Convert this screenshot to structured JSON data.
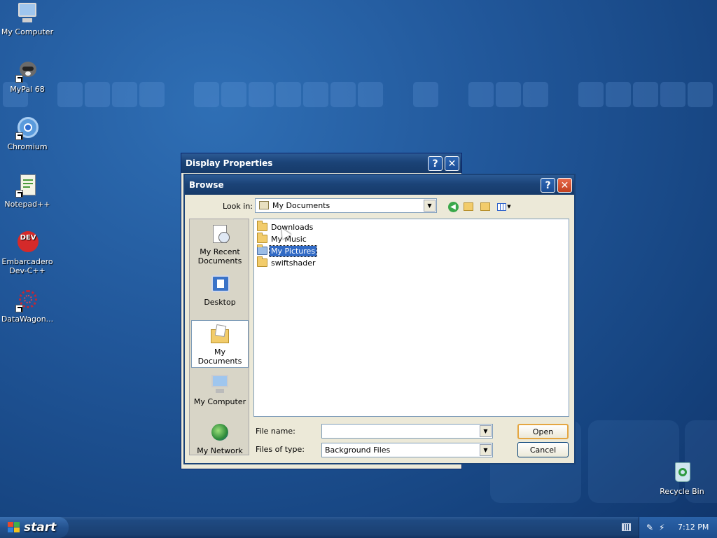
{
  "desktop": {
    "icons": [
      {
        "label": "My Computer",
        "icon": "my-computer-icon"
      },
      {
        "label": "MyPal 68",
        "icon": "mypal-raccoon-icon"
      },
      {
        "label": "Chromium",
        "icon": "chromium-icon"
      },
      {
        "label": "Notepad++",
        "icon": "notepadpp-icon"
      },
      {
        "label": "Embarcadero Dev-C++",
        "icon": "devcpp-icon",
        "badge": "DEV"
      },
      {
        "label": "DataWagon...",
        "icon": "datawagon-icon"
      },
      {
        "label": "Recycle Bin",
        "icon": "recycle-bin-icon"
      }
    ]
  },
  "display_properties": {
    "title": "Display Properties",
    "help": "?",
    "close": "✕"
  },
  "browse": {
    "title": "Browse",
    "help": "?",
    "close": "✕",
    "look_in_label": "Look in:",
    "look_in_value": "My Documents",
    "places": [
      {
        "label": "My Recent Documents",
        "icon": "recent-documents-icon"
      },
      {
        "label": "Desktop",
        "icon": "desktop-icon"
      },
      {
        "label": "My Documents",
        "icon": "my-documents-icon",
        "selected": true
      },
      {
        "label": "My Computer",
        "icon": "my-computer-icon"
      },
      {
        "label": "My Network",
        "icon": "my-network-icon"
      }
    ],
    "files": [
      {
        "name": "Downloads",
        "icon": "folder-icon",
        "selected": false
      },
      {
        "name": "My Music",
        "icon": "music-folder-icon",
        "selected": false
      },
      {
        "name": "My Pictures",
        "icon": "pictures-folder-icon",
        "selected": true
      },
      {
        "name": "swiftshader",
        "icon": "folder-icon",
        "selected": false
      }
    ],
    "file_name_label": "File name:",
    "file_name_value": "",
    "files_of_type_label": "Files of type:",
    "files_of_type_value": "Background Files",
    "open_label": "Open",
    "cancel_label": "Cancel"
  },
  "taskbar": {
    "start_label": "start",
    "clock": "7:12 PM"
  },
  "colors": {
    "titlebar": "#1b4377",
    "selection": "#316ac5",
    "close_button": "#c1401f"
  }
}
